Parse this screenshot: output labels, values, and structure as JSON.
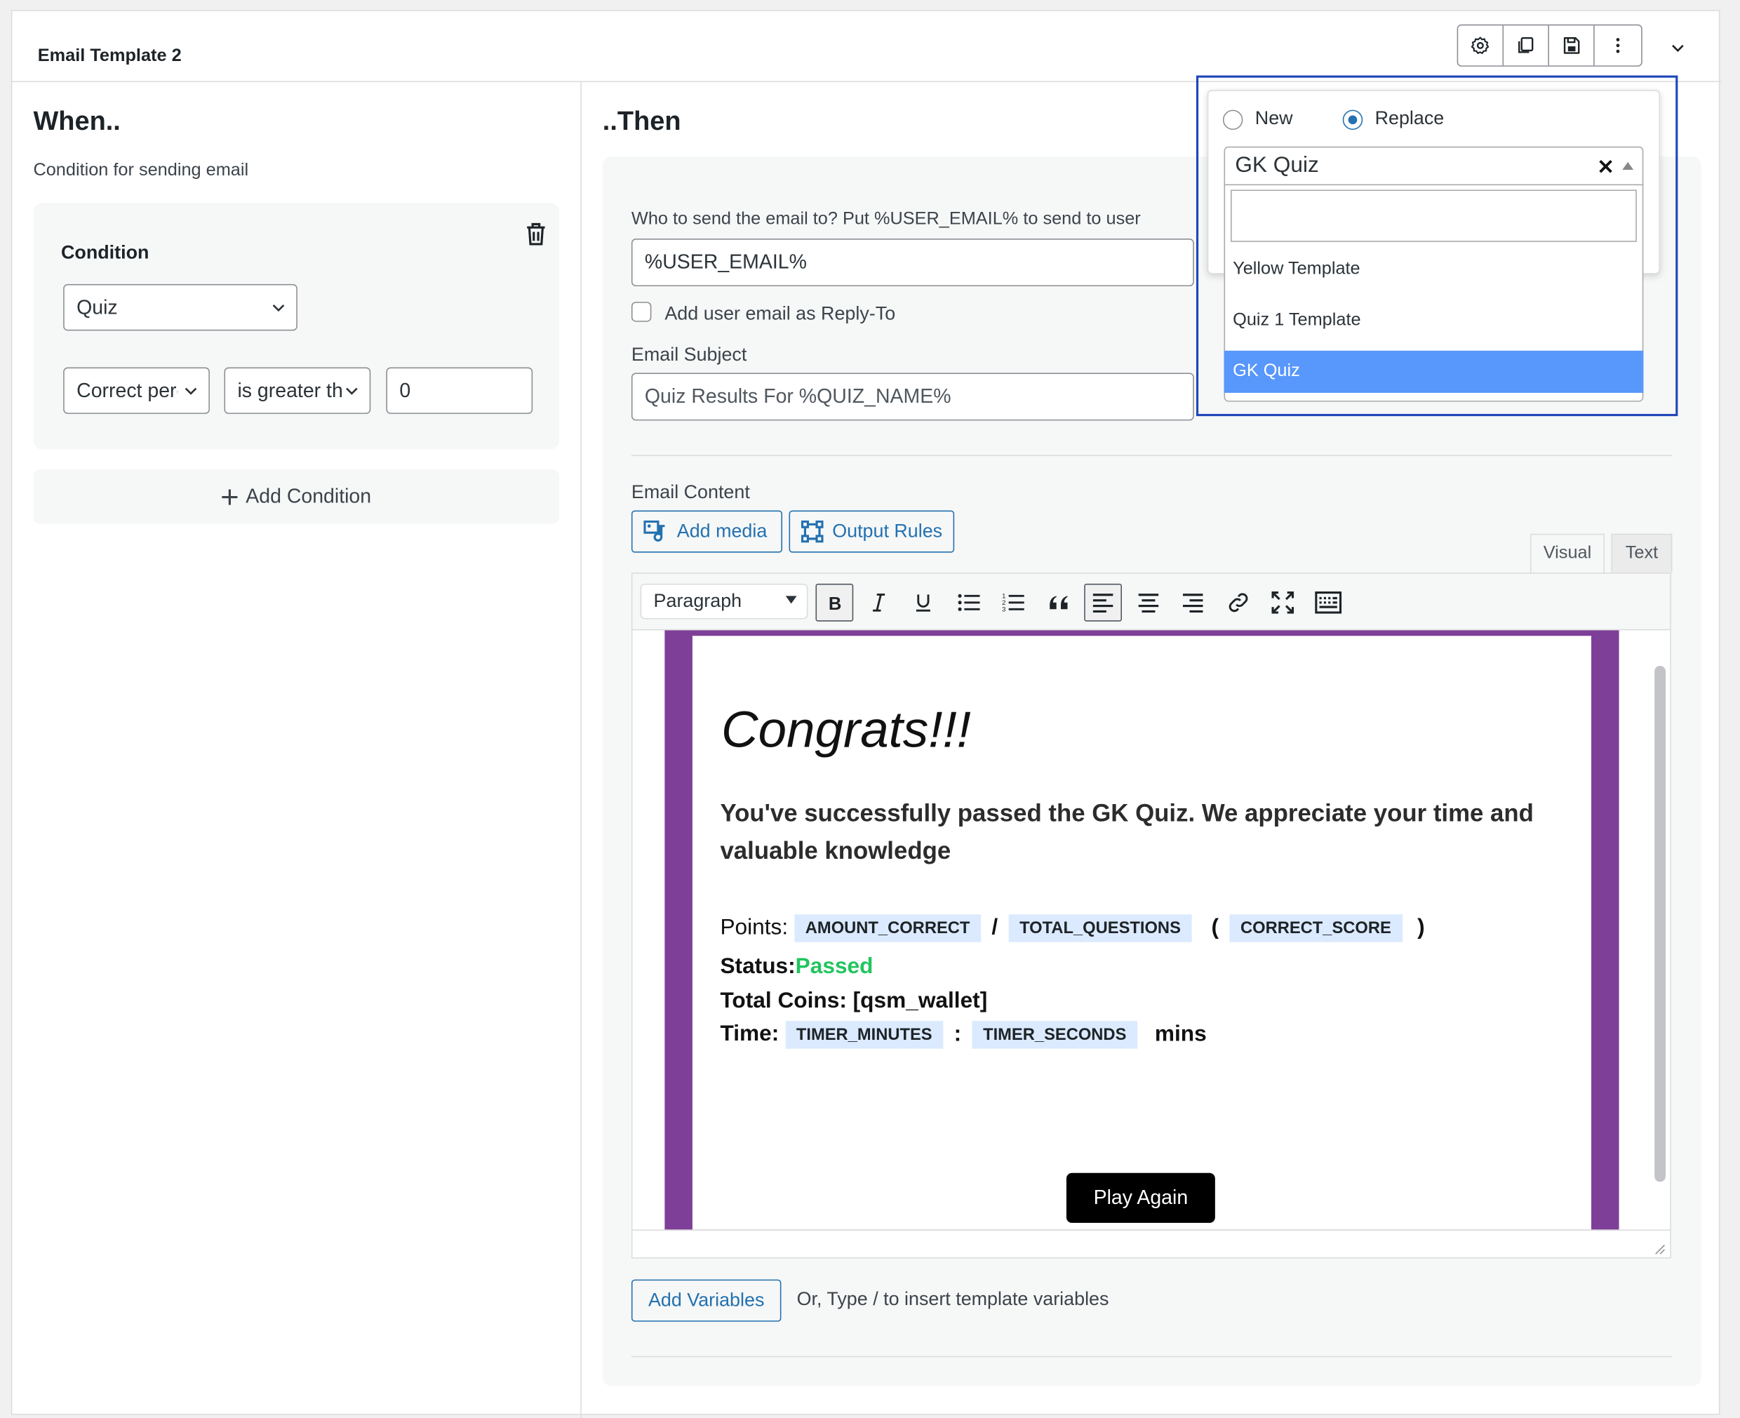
{
  "header": {
    "title": "Email Template 2"
  },
  "toolbar": {
    "icons": [
      "gear-icon",
      "duplicate-icon",
      "save-icon",
      "more-vertical-icon"
    ],
    "collapse_icon": "chevron-down-icon"
  },
  "when": {
    "title": "When..",
    "subtitle": "Condition for sending email",
    "condition_label": "Condition",
    "quiz_select": "Quiz",
    "field_select": "Correct percentage",
    "operator_select": "is greater than",
    "value": "0",
    "add_condition": "Add Condition"
  },
  "then": {
    "title": "..Then",
    "to_label": "Who to send the email to? Put %USER_EMAIL% to send to user",
    "to_value": "%USER_EMAIL%",
    "reply_to_label": "Add user email as Reply-To",
    "subject_label": "Email Subject",
    "subject_value": "Quiz Results For %QUIZ_NAME%",
    "content_label": "Email Content",
    "add_media": "Add media",
    "output_rules": "Output Rules",
    "tab_visual": "Visual",
    "tab_text": "Text",
    "format_select": "Paragraph",
    "add_variables": "Add Variables",
    "hint": "Or, Type / to insert template variables"
  },
  "email_body": {
    "heading": "Congrats!!!",
    "message": "You've successfully passed the GK Quiz. We appreciate your time and valuable knowledge",
    "points_label": "Points:",
    "amount_correct": "AMOUNT_CORRECT",
    "slash": "/",
    "total_questions": "TOTAL_QUESTIONS",
    "open_paren": "(",
    "correct_score": "CORRECT_SCORE",
    "close_paren": ")",
    "status_label": "Status:",
    "status_value": "Passed",
    "coins_label": "Total Coins: [qsm_wallet]",
    "time_label": "Time:",
    "timer_minutes": "TIMER_MINUTES",
    "colon": ":",
    "timer_seconds": "TIMER_SECONDS",
    "mins": "mins",
    "play_again": "Play Again",
    "border_color": "#7e3f98",
    "status_color": "#22c55e"
  },
  "template_popup": {
    "radio_new": "New",
    "radio_replace": "Replace",
    "selected_radio": "Replace",
    "selected_template": "GK Quiz",
    "search_value": "",
    "options": [
      "Yellow Template",
      "Quiz 1 Template",
      "GK Quiz"
    ],
    "highlighted_option": "GK Quiz",
    "accent_color": "#5897fb"
  }
}
